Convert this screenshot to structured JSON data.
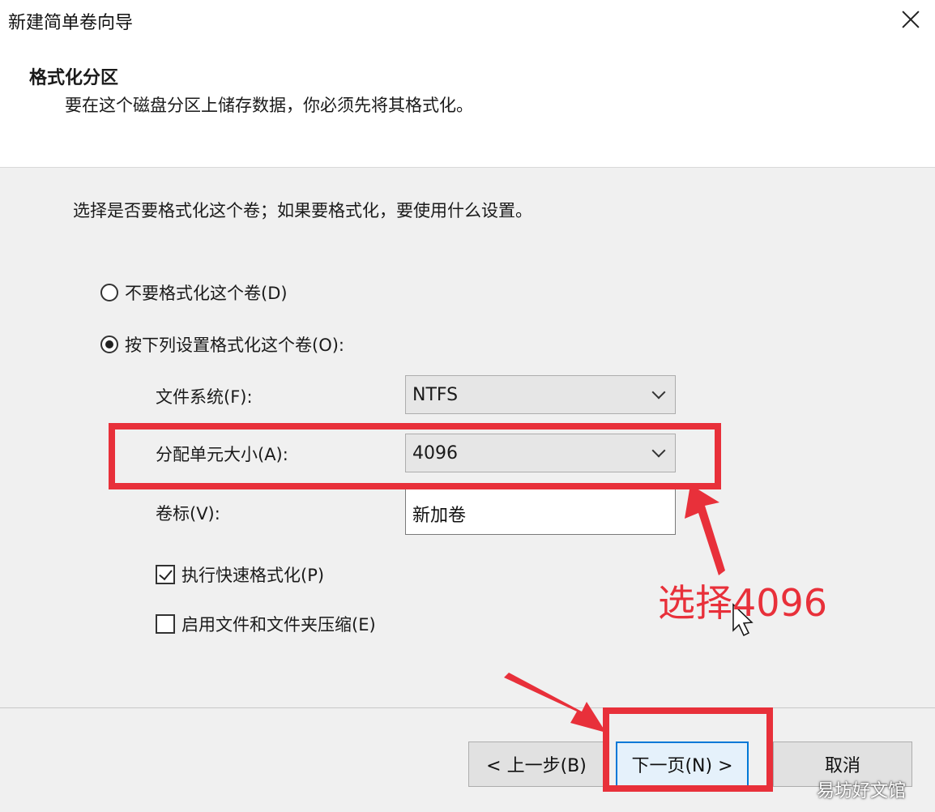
{
  "window": {
    "title": "新建简单卷向导",
    "close_icon": "close-icon"
  },
  "header": {
    "heading": "格式化分区",
    "description": "要在这个磁盘分区上储存数据，你必须先将其格式化。"
  },
  "body": {
    "instruction": "选择是否要格式化这个卷；如果要格式化，要使用什么设置。",
    "options": {
      "no_format": {
        "label": "不要格式化这个卷(D)",
        "selected": false
      },
      "format": {
        "label": "按下列设置格式化这个卷(O):",
        "selected": true
      }
    },
    "file_system": {
      "label": "文件系统(F):",
      "value": "NTFS"
    },
    "allocation_unit": {
      "label": "分配单元大小(A):",
      "value": "4096"
    },
    "volume_label": {
      "label": "卷标(V):",
      "value": "新加卷"
    },
    "quick_format": {
      "label": "执行快速格式化(P)",
      "checked": true
    },
    "compression": {
      "label": "启用文件和文件夹压缩(E)",
      "checked": false
    }
  },
  "buttons": {
    "back": "< 上一步(B)",
    "next": "下一页(N) >",
    "cancel": "取消"
  },
  "annotations": {
    "callout": "选择4096",
    "color": "#e8303a"
  },
  "watermark": "易坊好文馆"
}
